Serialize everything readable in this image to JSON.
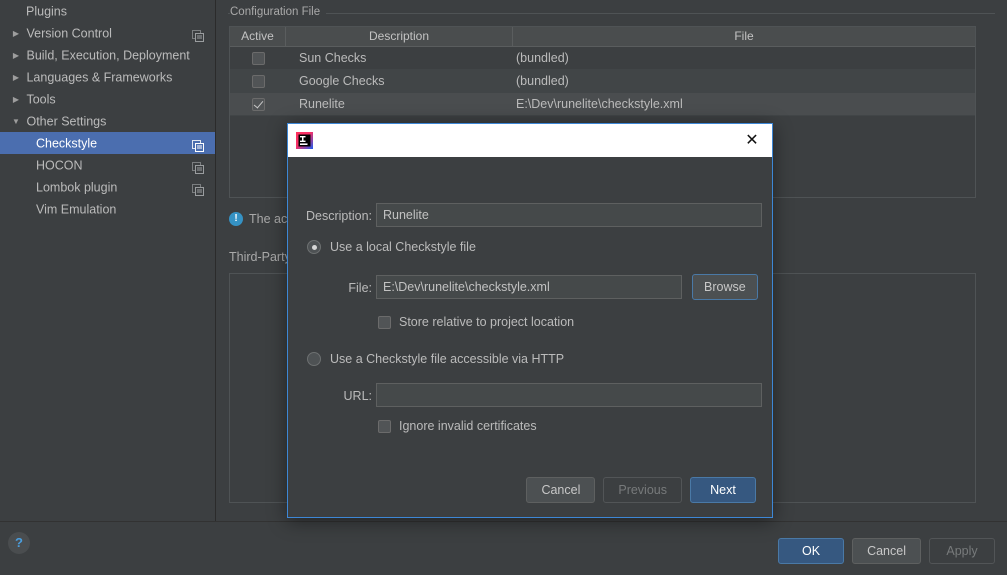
{
  "sidebar": {
    "items": [
      {
        "label": "Plugins",
        "arrow": "",
        "level": 0,
        "icon": "",
        "selected": false
      },
      {
        "label": "Version Control",
        "arrow": "▶",
        "level": 0,
        "icon": "copy-icon",
        "selected": false
      },
      {
        "label": "Build, Execution, Deployment",
        "arrow": "▶",
        "level": 0,
        "icon": "",
        "selected": false
      },
      {
        "label": "Languages & Frameworks",
        "arrow": "▶",
        "level": 0,
        "icon": "",
        "selected": false
      },
      {
        "label": "Tools",
        "arrow": "▶",
        "level": 0,
        "icon": "",
        "selected": false
      },
      {
        "label": "Other Settings",
        "arrow": "▼",
        "level": 0,
        "icon": "",
        "selected": false
      },
      {
        "label": "Checkstyle",
        "arrow": "",
        "level": 1,
        "icon": "copy-icon",
        "selected": true
      },
      {
        "label": "HOCON",
        "arrow": "",
        "level": 1,
        "icon": "copy-icon",
        "selected": false
      },
      {
        "label": "Lombok plugin",
        "arrow": "",
        "level": 1,
        "icon": "copy-icon",
        "selected": false
      },
      {
        "label": "Vim Emulation",
        "arrow": "",
        "level": 1,
        "icon": "",
        "selected": false
      }
    ]
  },
  "main": {
    "group_title": "Configuration File",
    "table": {
      "columns": [
        "Active",
        "Description",
        "File"
      ],
      "rows": [
        {
          "active": false,
          "description": "Sun Checks",
          "file": "(bundled)",
          "selected": false
        },
        {
          "active": false,
          "description": "Google Checks",
          "file": "(bundled)",
          "selected": false
        },
        {
          "active": true,
          "description": "Runelite",
          "file": "E:\\Dev\\runelite\\checkstyle.xml",
          "selected": true
        }
      ]
    },
    "toolbar": {
      "add": "+",
      "remove": "−",
      "edit": "pencil-icon",
      "move_up": "arrow-up-icon",
      "move_down": "arrow-down-icon"
    },
    "info_text": "The act",
    "info_icon": "!",
    "third_party_title": "Third-Party"
  },
  "bottom": {
    "help": "?",
    "ok": "OK",
    "cancel": "Cancel",
    "apply": "Apply"
  },
  "dialog": {
    "title": "",
    "icon": "intellij-idea-icon",
    "close": "✕",
    "description_label": "Description:",
    "description_value": "Runelite",
    "local_radio_label": "Use a local Checkstyle file",
    "local_radio_selected": true,
    "file_label": "File:",
    "file_value": "E:\\Dev\\runelite\\checkstyle.xml",
    "browse_label": "Browse",
    "store_relative_label": "Store relative to project location",
    "store_relative_checked": false,
    "http_radio_label": "Use a Checkstyle file accessible via HTTP",
    "http_radio_selected": false,
    "url_label": "URL:",
    "url_value": "",
    "url_placeholder": "",
    "ignore_certs_label": "Ignore invalid certificates",
    "ignore_certs_checked": false,
    "cancel_label": "Cancel",
    "previous_label": "Previous",
    "next_label": "Next"
  },
  "colors": {
    "background": "#3c3f41",
    "selection_blue": "#4b6eaf",
    "accent_blue": "#3d87d6",
    "primary_button": "#365880",
    "add_green": "#62b543",
    "info_blue": "#3592c4"
  }
}
